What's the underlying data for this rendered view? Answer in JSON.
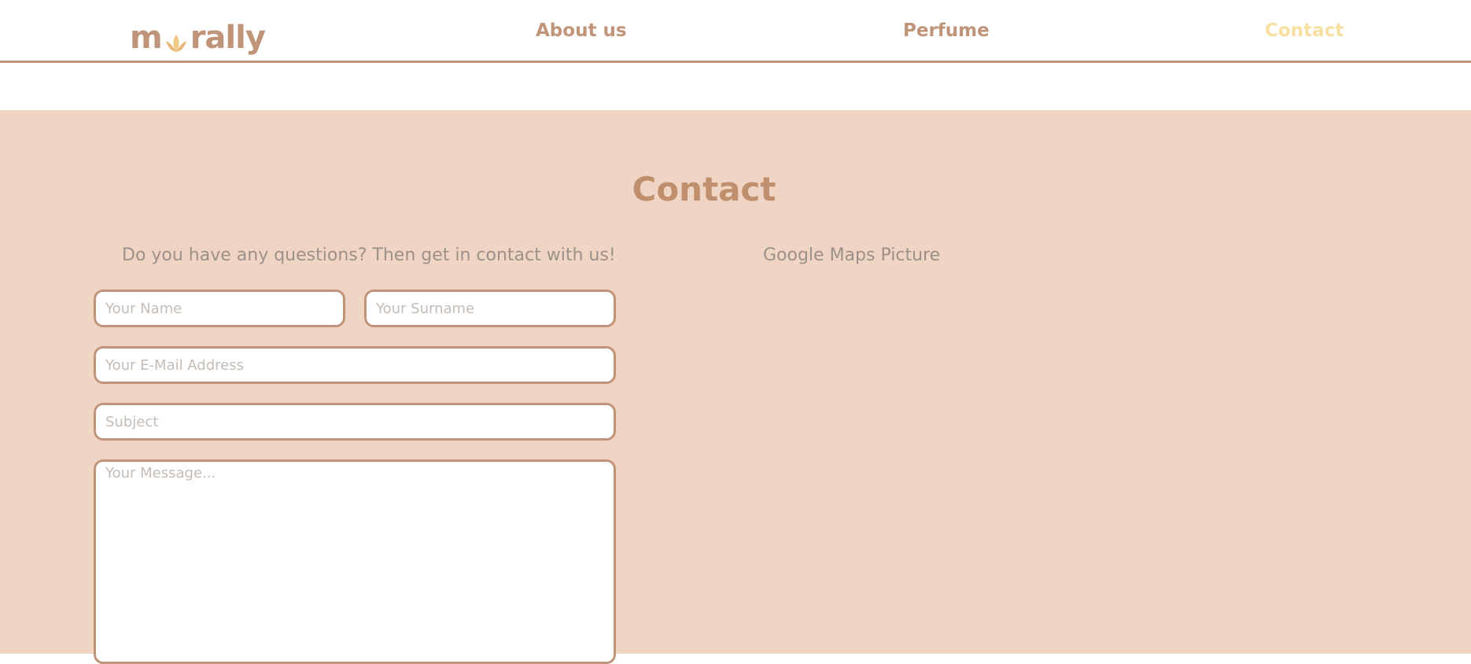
{
  "nav": {
    "logo_text_left": "m",
    "logo_text_right": "rally",
    "logo_icon": "lotus-icon",
    "items": [
      {
        "label": "About us",
        "active": false
      },
      {
        "label": "Perfume",
        "active": false
      },
      {
        "label": "Contact",
        "active": true
      }
    ]
  },
  "contact": {
    "title": "Contact",
    "intro": "Do you have any questions? Then get in contact with us!",
    "map_placeholder": "Google Maps Picture",
    "form": {
      "name_placeholder": "Your Name",
      "surname_placeholder": "Your Surname",
      "email_placeholder": "Your E-Mail Address",
      "subject_placeholder": "Subject",
      "message_placeholder": "Your Message..."
    }
  },
  "colors": {
    "brand": "#bf9478",
    "active_nav": "#f7dfa0",
    "section_bg": "#f0d5c4",
    "title": "#c0906e",
    "body_text": "#9c9189",
    "placeholder": "#c4bcb6"
  }
}
